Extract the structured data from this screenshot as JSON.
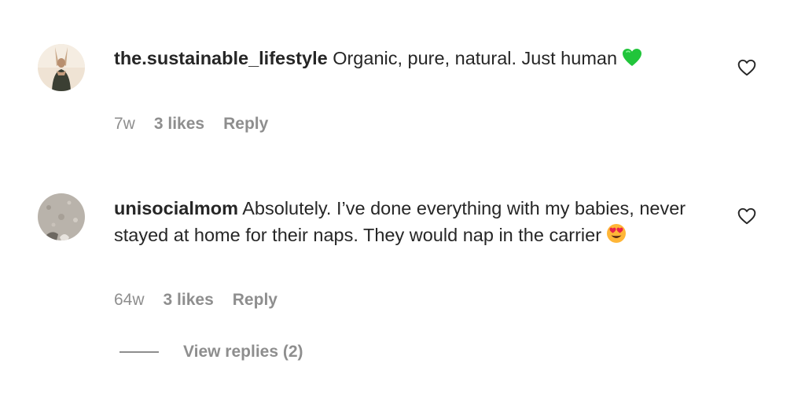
{
  "comments": [
    {
      "username": "the.sustainable_lifestyle",
      "text": "Organic, pure, natural. Just human",
      "emoji": "green-heart",
      "time": "7w",
      "likes": "3 likes",
      "reply": "Reply"
    },
    {
      "username": "unisocialmom",
      "text": "Absolutely. I’ve done everything with my babies, never stayed at home for their naps. They would nap in the carrier",
      "emoji": "heart-eyes-face",
      "time": "64w",
      "likes": "3 likes",
      "reply": "Reply"
    }
  ],
  "view_replies": "View replies (2)",
  "icons": {
    "like": "heart-outline-icon"
  },
  "colors": {
    "text": "#262626",
    "muted": "#8e8e8e",
    "green_heart": "#21c53b",
    "emoji_face": "#ffb637"
  }
}
